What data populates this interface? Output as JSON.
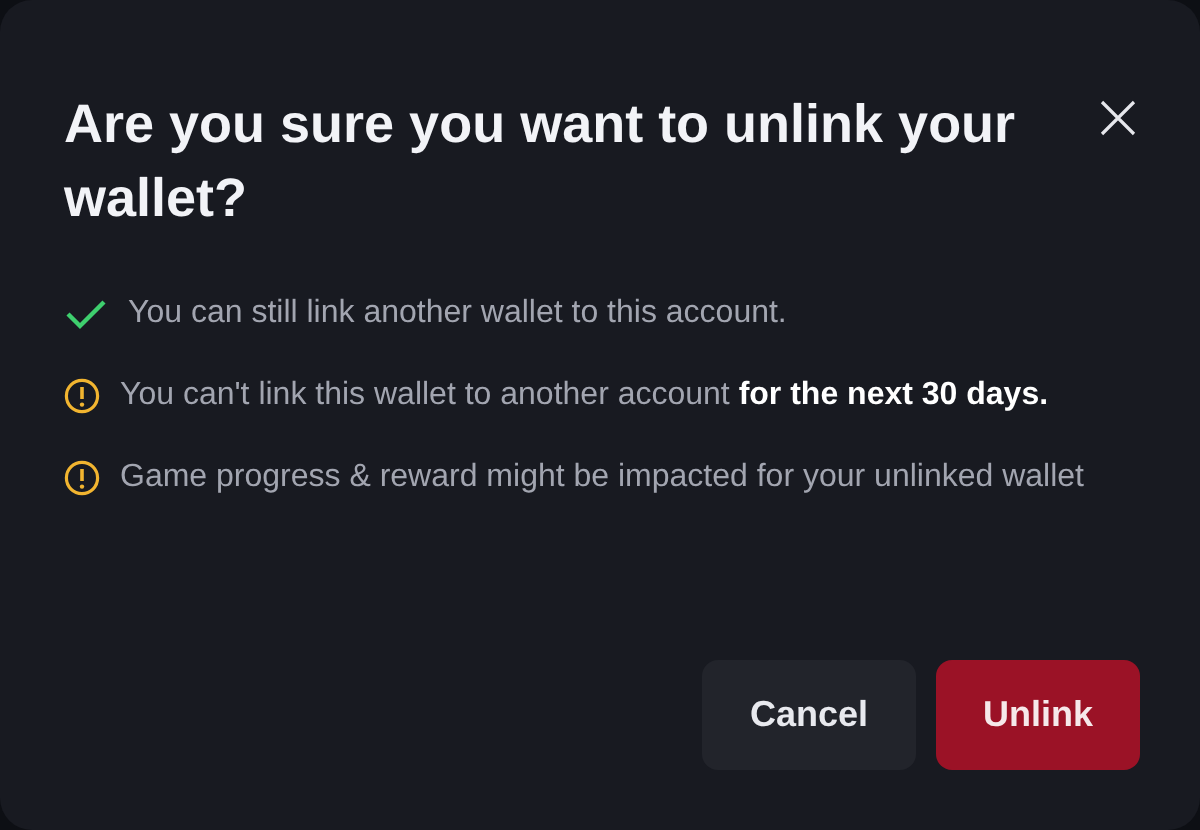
{
  "dialog": {
    "title": "Are you sure you want to unlink your wallet?",
    "items": [
      {
        "kind": "check",
        "text": "You can still link another wallet to this account."
      },
      {
        "kind": "warning",
        "text": "You can't link this wallet to another account **for the next 30 days.**"
      },
      {
        "kind": "warning",
        "text": "Game progress & reward might be impacted for your unlinked wallet"
      }
    ],
    "buttons": [
      {
        "kind": "secondary",
        "label": "Cancel"
      },
      {
        "kind": "danger",
        "label": "Unlink"
      }
    ]
  }
}
